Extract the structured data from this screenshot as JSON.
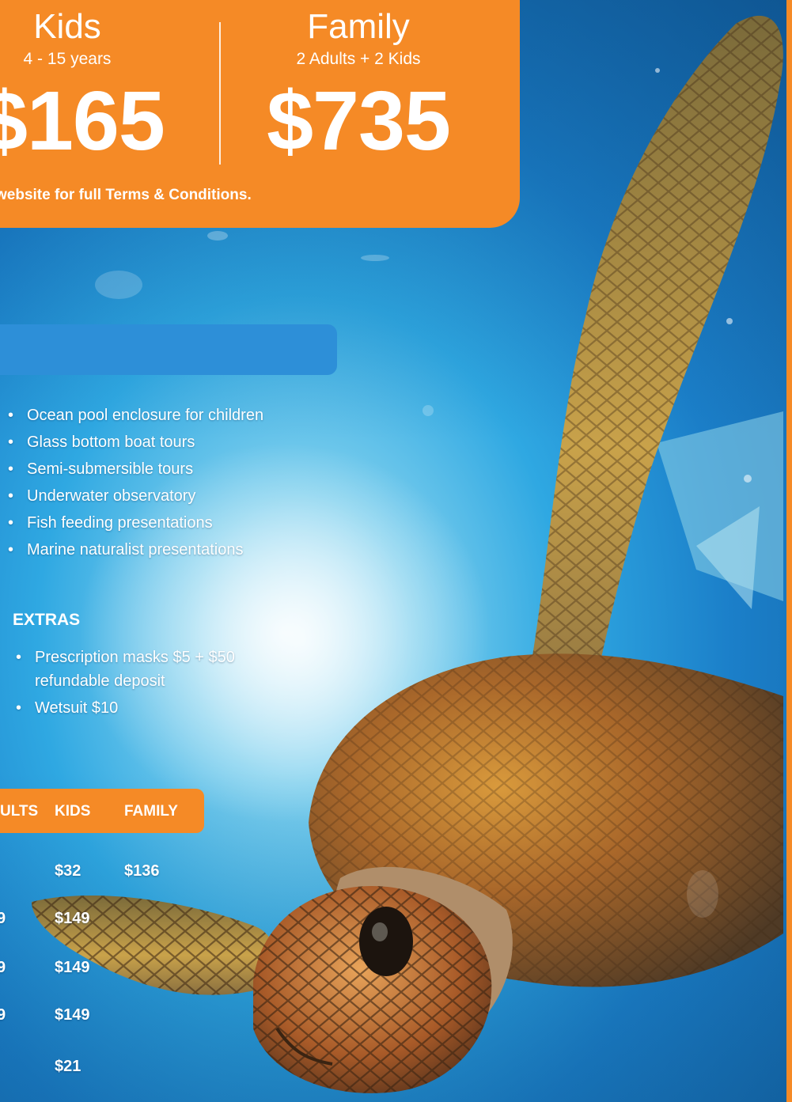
{
  "pricing": {
    "kids": {
      "title": "Kids",
      "subtitle": "4 - 15 years",
      "price": "$165"
    },
    "family": {
      "title": "Family",
      "subtitle": "2 Adults + 2 Kids",
      "price": "$735"
    },
    "terms": "website for full Terms & Conditions."
  },
  "features": [
    "Ocean pool enclosure for children",
    "Glass bottom boat tours",
    "Semi-submersible tours",
    "Underwater observatory",
    "Fish feeding presentations",
    "Marine naturalist presentations"
  ],
  "extras": {
    "heading": "EXTRAS",
    "items": [
      "Prescription masks $5 + $50 refundable deposit",
      "Wetsuit $10"
    ]
  },
  "rates_table": {
    "headers": [
      "ULTS",
      "KIDS",
      "FAMILY"
    ],
    "rows": [
      {
        "adults": "",
        "kids": "$32",
        "family": "$136"
      },
      {
        "adults": "9",
        "kids": "$149",
        "family": ""
      },
      {
        "adults": "9",
        "kids": "$149",
        "family": ""
      },
      {
        "adults": "9",
        "kids": "$149",
        "family": ""
      },
      {
        "adults": "",
        "kids": "$21",
        "family": ""
      }
    ]
  },
  "colors": {
    "accent_orange": "#f58a26",
    "band_blue": "#2d8fd8"
  },
  "image": {
    "subject": "sea-turtle-photo"
  }
}
